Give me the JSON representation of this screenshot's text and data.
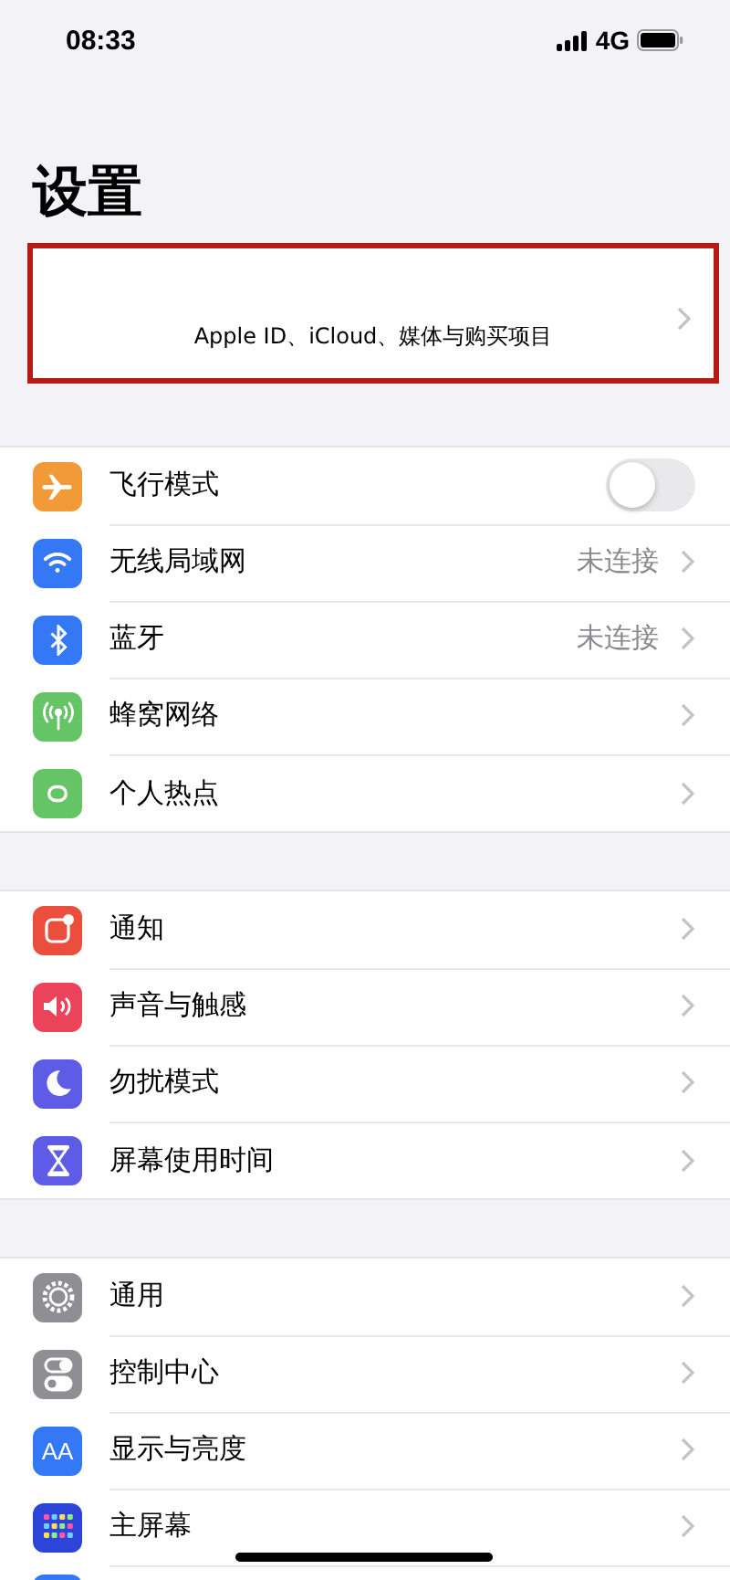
{
  "status_bar": {
    "time": "08:33",
    "network": "4G"
  },
  "title": "设置",
  "account": {
    "subtitle": "Apple ID、iCloud、媒体与购买项目",
    "highlighted": true
  },
  "groups": [
    {
      "items": [
        {
          "kind": "toggle",
          "label": "飞行模式",
          "color": "#f19a37",
          "on": false
        },
        {
          "kind": "link",
          "label": "无线局域网",
          "color": "#3478f6",
          "value": "未连接"
        },
        {
          "kind": "link",
          "label": "蓝牙",
          "color": "#3478f6",
          "value": "未连接"
        },
        {
          "kind": "link",
          "label": "蜂窝网络",
          "color": "#65c466"
        },
        {
          "kind": "link",
          "label": "个人热点",
          "color": "#65c466"
        }
      ]
    },
    {
      "items": [
        {
          "kind": "link",
          "label": "通知",
          "color": "#eb4e3d"
        },
        {
          "kind": "link",
          "label": "声音与触感",
          "color": "#eb445a"
        },
        {
          "kind": "link",
          "label": "勿扰模式",
          "color": "#5e5ce6"
        },
        {
          "kind": "link",
          "label": "屏幕使用时间",
          "color": "#5e5ce6"
        }
      ]
    },
    {
      "items": [
        {
          "kind": "link",
          "label": "通用",
          "color": "#8e8e93"
        },
        {
          "kind": "link",
          "label": "控制中心",
          "color": "#8e8e93"
        },
        {
          "kind": "link",
          "label": "显示与亮度",
          "color": "#3478f6",
          "icon_text": "AA"
        },
        {
          "kind": "link",
          "label": "主屏幕",
          "color": "#2c45d8"
        },
        {
          "kind": "partial",
          "color": "#3478f6"
        }
      ]
    }
  ]
}
